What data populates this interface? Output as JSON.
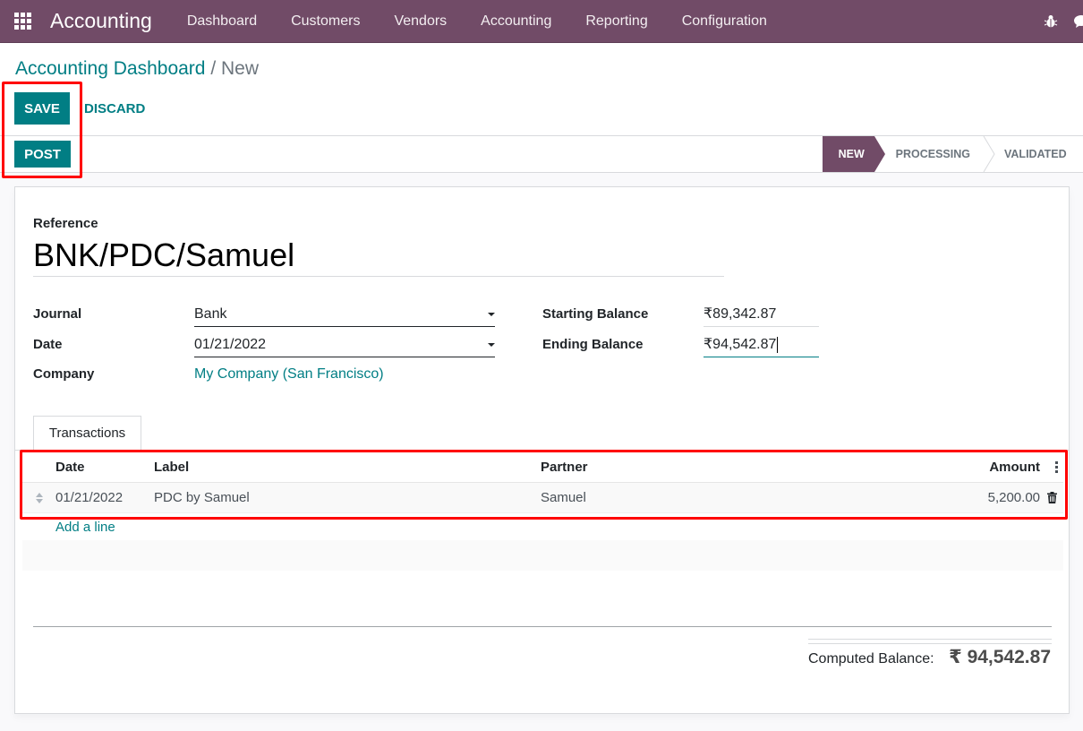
{
  "navbar": {
    "app_name": "Accounting",
    "menu": [
      "Dashboard",
      "Customers",
      "Vendors",
      "Accounting",
      "Reporting",
      "Configuration"
    ],
    "icons": [
      "apps-grid-icon",
      "bug-icon",
      "chat-icon"
    ],
    "bg_color": "#714b67"
  },
  "breadcrumb": {
    "parent": "Accounting Dashboard",
    "separator": " / ",
    "current": "New"
  },
  "actions": {
    "save_label": "SAVE",
    "discard_label": "DISCARD",
    "post_label": "POST",
    "primary_color": "#017e84"
  },
  "status": {
    "stages": [
      "NEW",
      "PROCESSING",
      "VALIDATED"
    ],
    "current": "NEW"
  },
  "form": {
    "reference_label": "Reference",
    "reference_value": "BNK/PDC/Samuel",
    "journal_label": "Journal",
    "journal_value": "Bank",
    "date_label": "Date",
    "date_value": "01/21/2022",
    "company_label": "Company",
    "company_value": "My Company (San Francisco)",
    "starting_balance_label": "Starting Balance",
    "starting_balance_value": "₹89,342.87",
    "ending_balance_label": "Ending Balance",
    "ending_balance_value": "₹94,542.87"
  },
  "notebook": {
    "tabs": [
      "Transactions"
    ],
    "active_tab": "Transactions"
  },
  "transactions": {
    "columns": [
      "Date",
      "Label",
      "Partner",
      "Amount"
    ],
    "rows": [
      {
        "date": "01/21/2022",
        "label": "PDC by Samuel",
        "partner": "Samuel",
        "amount": "5,200.00"
      }
    ],
    "add_line_label": "Add a line"
  },
  "totals": {
    "computed_balance_label": "Computed Balance:",
    "computed_balance_value": "₹ 94,542.87"
  }
}
